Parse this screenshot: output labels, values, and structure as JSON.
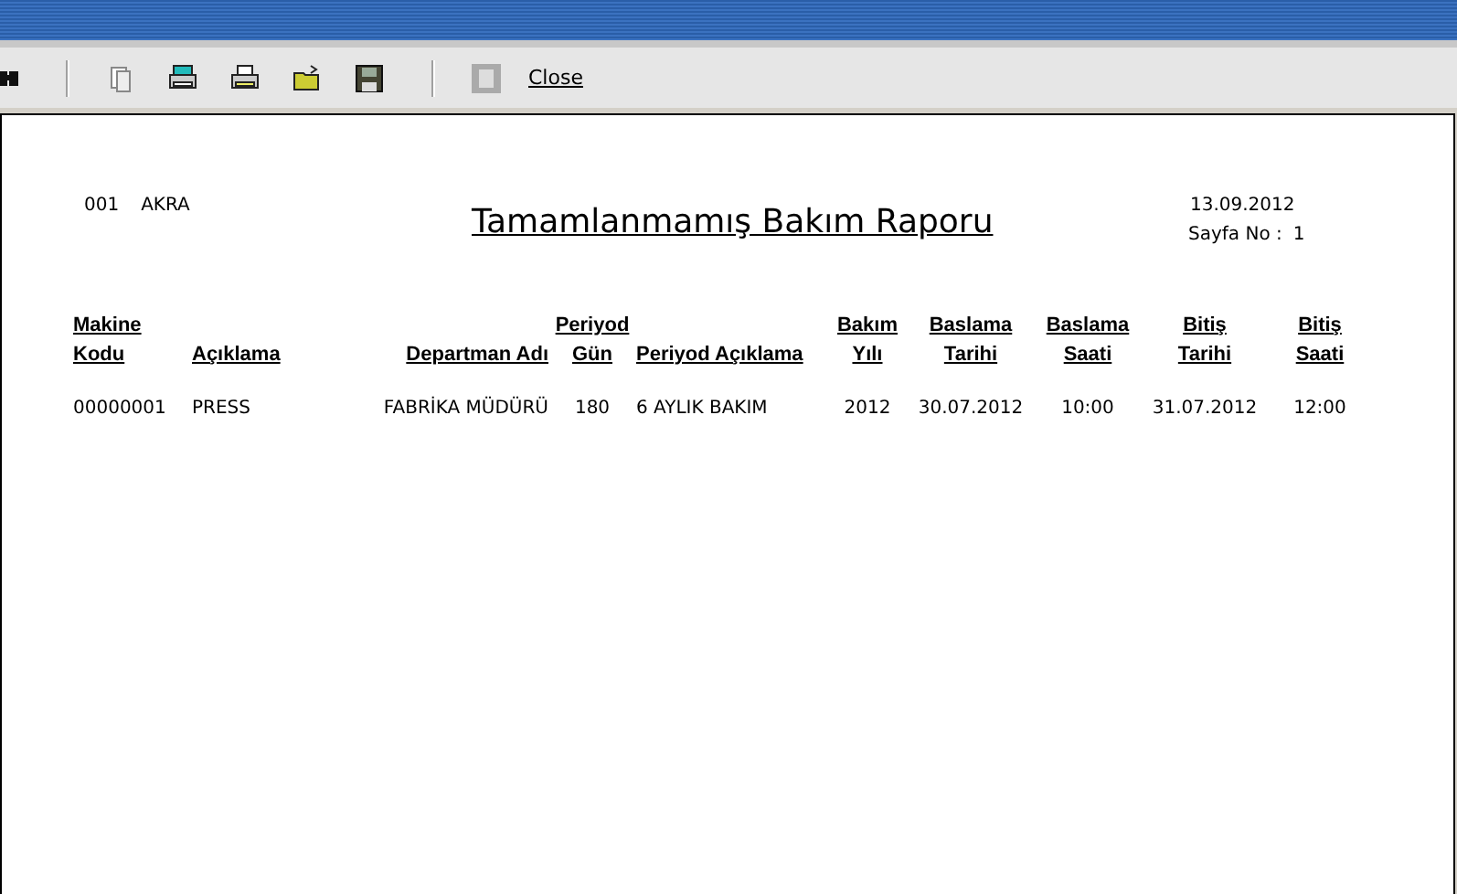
{
  "toolbar": {
    "close_label": "Close"
  },
  "report": {
    "company_code": "001",
    "company_name": "AKRA",
    "title": "Tamamlanmamış Bakım Raporu",
    "date": "13.09.2012",
    "page_label": "Sayfa No :",
    "page_number": "1",
    "columns": [
      {
        "lines": [
          "Makine",
          "Kodu"
        ]
      },
      {
        "lines": [
          "Açıklama"
        ]
      },
      {
        "lines": [
          "Departman Adı"
        ]
      },
      {
        "lines": [
          "Periyod",
          "Gün"
        ]
      },
      {
        "lines": [
          "Periyod Açıklama"
        ]
      },
      {
        "lines": [
          "Bakım",
          "Yılı"
        ]
      },
      {
        "lines": [
          "Baslama",
          "Tarihi"
        ]
      },
      {
        "lines": [
          "Baslama",
          "Saati"
        ]
      },
      {
        "lines": [
          "Bitiş",
          "Tarihi"
        ]
      },
      {
        "lines": [
          "Bitiş",
          "Saati"
        ]
      }
    ],
    "rows": [
      [
        "00000001",
        "PRESS",
        "FABRİKA MÜDÜRÜ",
        "180",
        "6 AYLIK BAKIM",
        "2012",
        "30.07.2012",
        "10:00",
        "31.07.2012",
        "12:00"
      ]
    ]
  }
}
